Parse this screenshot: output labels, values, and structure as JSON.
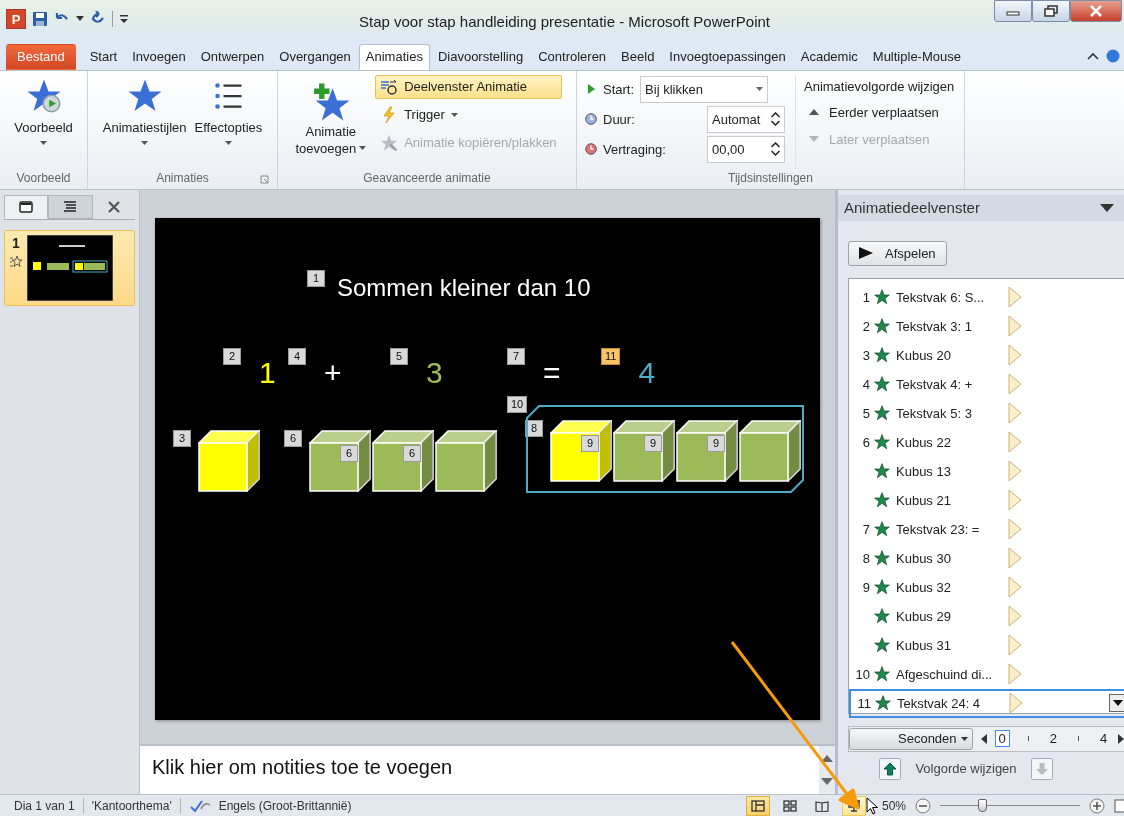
{
  "window": {
    "title": "Stap voor stap handleiding presentatie  -  Microsoft PowerPoint",
    "logo_letter": "P"
  },
  "ribbon_tabs": [
    {
      "label": "Bestand",
      "kind": "file",
      "selected": false
    },
    {
      "label": "Start",
      "kind": "tab",
      "selected": false
    },
    {
      "label": "Invoegen",
      "kind": "tab",
      "selected": false
    },
    {
      "label": "Ontwerpen",
      "kind": "tab",
      "selected": false
    },
    {
      "label": "Overgangen",
      "kind": "tab",
      "selected": false
    },
    {
      "label": "Animaties",
      "kind": "tab",
      "selected": true
    },
    {
      "label": "Diavoorstelling",
      "kind": "tab",
      "selected": false
    },
    {
      "label": "Controleren",
      "kind": "tab",
      "selected": false
    },
    {
      "label": "Beeld",
      "kind": "tab",
      "selected": false
    },
    {
      "label": "Invoegtoepassingen",
      "kind": "tab",
      "selected": false
    },
    {
      "label": "Academic",
      "kind": "tab",
      "selected": false
    },
    {
      "label": "Multiple-Mouse",
      "kind": "tab",
      "selected": false
    }
  ],
  "ribbon": {
    "preview": {
      "button": "Voorbeeld",
      "group": "Voorbeeld"
    },
    "animations": {
      "group": "Animaties",
      "buttons": [
        {
          "label": "Animatiestijlen",
          "kind": "styles"
        },
        {
          "label": "Effectopties",
          "kind": "options"
        }
      ]
    },
    "advanced": {
      "group": "Geavanceerde animatie",
      "add_button": [
        "Animatie",
        "toevoegen"
      ],
      "commands": [
        {
          "label": "Deelvenster Animatie",
          "kind": "pane",
          "selected": true,
          "disabled": false,
          "dropdown": false
        },
        {
          "label": "Trigger",
          "kind": "trigger",
          "selected": false,
          "disabled": false,
          "dropdown": true
        },
        {
          "label": "Animatie kopiëren/plakken",
          "kind": "painter",
          "selected": false,
          "disabled": true,
          "dropdown": false
        }
      ]
    },
    "timing": {
      "group": "Tijdsinstellingen",
      "fields": [
        {
          "label": "Start:",
          "value": "Bij klikken",
          "kind": "dropdown"
        },
        {
          "label": "Duur:",
          "value": "Automat",
          "kind": "spinner"
        },
        {
          "label": "Vertraging:",
          "value": "00,00",
          "kind": "spinner"
        }
      ],
      "reorder_title": "Animatievolgorde wijzigen",
      "reorder": [
        {
          "label": "Eerder verplaatsen",
          "kind": "up",
          "disabled": false
        },
        {
          "label": "Later verplaatsen",
          "kind": "down",
          "disabled": true
        }
      ]
    }
  },
  "slides_panel": {
    "tabs": [
      {
        "kind": "slides",
        "selected": true
      },
      {
        "kind": "outline",
        "selected": false
      }
    ],
    "slides": [
      {
        "number": "1",
        "selected": true,
        "animated": true
      }
    ]
  },
  "slide": {
    "title_tag": {
      "label": "1",
      "selected": false
    },
    "title": "Sommen kleiner dan 10",
    "equation": [
      {
        "tag": {
          "label": "2",
          "selected": false
        },
        "text": "1",
        "color": "#ffff00"
      },
      {
        "tag": {
          "label": "4",
          "selected": false
        },
        "text": "+",
        "color": "#ffffff"
      },
      {
        "tag": {
          "label": "5",
          "selected": false
        },
        "text": "3",
        "color": "#9bbb59"
      },
      {
        "tag": {
          "label": "7",
          "selected": false
        },
        "text": "=",
        "color": "#ffffff"
      },
      {
        "tag": {
          "label": "11",
          "selected": true
        },
        "text": "4",
        "color": "#4bacc6"
      }
    ],
    "cube_groups": [
      {
        "grouped": false,
        "tag": {
          "label": "3",
          "selected": false
        },
        "cubes": [
          {
            "color": "#ffff00"
          }
        ]
      },
      {
        "grouped": false,
        "tag": {
          "label": "6",
          "selected": false
        },
        "cubes": [
          {
            "color": "#9bbb59",
            "corner_tag": {
              "label": "6",
              "selected": false
            }
          },
          {
            "color": "#9bbb59",
            "corner_tag": {
              "label": "6",
              "selected": false
            }
          },
          {
            "color": "#9bbb59"
          }
        ]
      },
      {
        "grouped": true,
        "group_tag": {
          "label": "10",
          "selected": false
        },
        "tag": {
          "label": "8",
          "selected": false
        },
        "cubes": [
          {
            "color": "#ffff00",
            "corner_tag": {
              "label": "9",
              "selected": false
            }
          },
          {
            "color": "#9bbb59",
            "corner_tag": {
              "label": "9",
              "selected": false
            }
          },
          {
            "color": "#9bbb59",
            "corner_tag": {
              "label": "9",
              "selected": false
            }
          },
          {
            "color": "#9bbb59"
          }
        ]
      }
    ]
  },
  "notes": {
    "placeholder": "Klik hier om notities toe te voegen"
  },
  "animation_pane": {
    "title": "Animatiedeelvenster",
    "play_button": "Afspelen",
    "items": [
      {
        "number": "1",
        "label": "Tekstvak 6: S...",
        "selected": false
      },
      {
        "number": "2",
        "label": "Tekstvak 3: 1",
        "selected": false
      },
      {
        "number": "3",
        "label": "Kubus 20",
        "selected": false
      },
      {
        "number": "4",
        "label": "Tekstvak 4: +",
        "selected": false
      },
      {
        "number": "5",
        "label": "Tekstvak 5: 3",
        "selected": false
      },
      {
        "number": "6",
        "label": "Kubus 22",
        "selected": false
      },
      {
        "label": "Kubus 13",
        "selected": false
      },
      {
        "label": "Kubus 21",
        "selected": false
      },
      {
        "number": "7",
        "label": "Tekstvak 23: =",
        "selected": false
      },
      {
        "number": "8",
        "label": "Kubus 30",
        "selected": false
      },
      {
        "number": "9",
        "label": "Kubus 32",
        "selected": false
      },
      {
        "label": "Kubus 29",
        "selected": false
      },
      {
        "label": "Kubus 31",
        "selected": false
      },
      {
        "number": "10",
        "label": "Afgeschuind di...",
        "selected": false
      },
      {
        "number": "11",
        "label": "Tekstvak 24: 4",
        "selected": true
      }
    ],
    "timeline": {
      "unit": "Seconden",
      "ticks": [
        {
          "label": "0",
          "selected": true
        },
        {
          "label": "2",
          "selected": false
        },
        {
          "label": "4",
          "selected": false
        }
      ]
    },
    "reorder_label": "Volgorde wijzigen"
  },
  "status_bar": {
    "slide": "Dia 1 van 1",
    "theme": "'Kantoorthema'",
    "language": "Engels (Groot-Brittannië)",
    "views": [
      {
        "kind": "normal",
        "selected": true,
        "hovered": false
      },
      {
        "kind": "sorter",
        "selected": false,
        "hovered": false
      },
      {
        "kind": "reading",
        "selected": false,
        "hovered": false
      },
      {
        "kind": "slideshow",
        "selected": false,
        "hovered": true
      }
    ],
    "zoom": "50%",
    "zoom_slider": {
      "level": 0.3
    }
  }
}
